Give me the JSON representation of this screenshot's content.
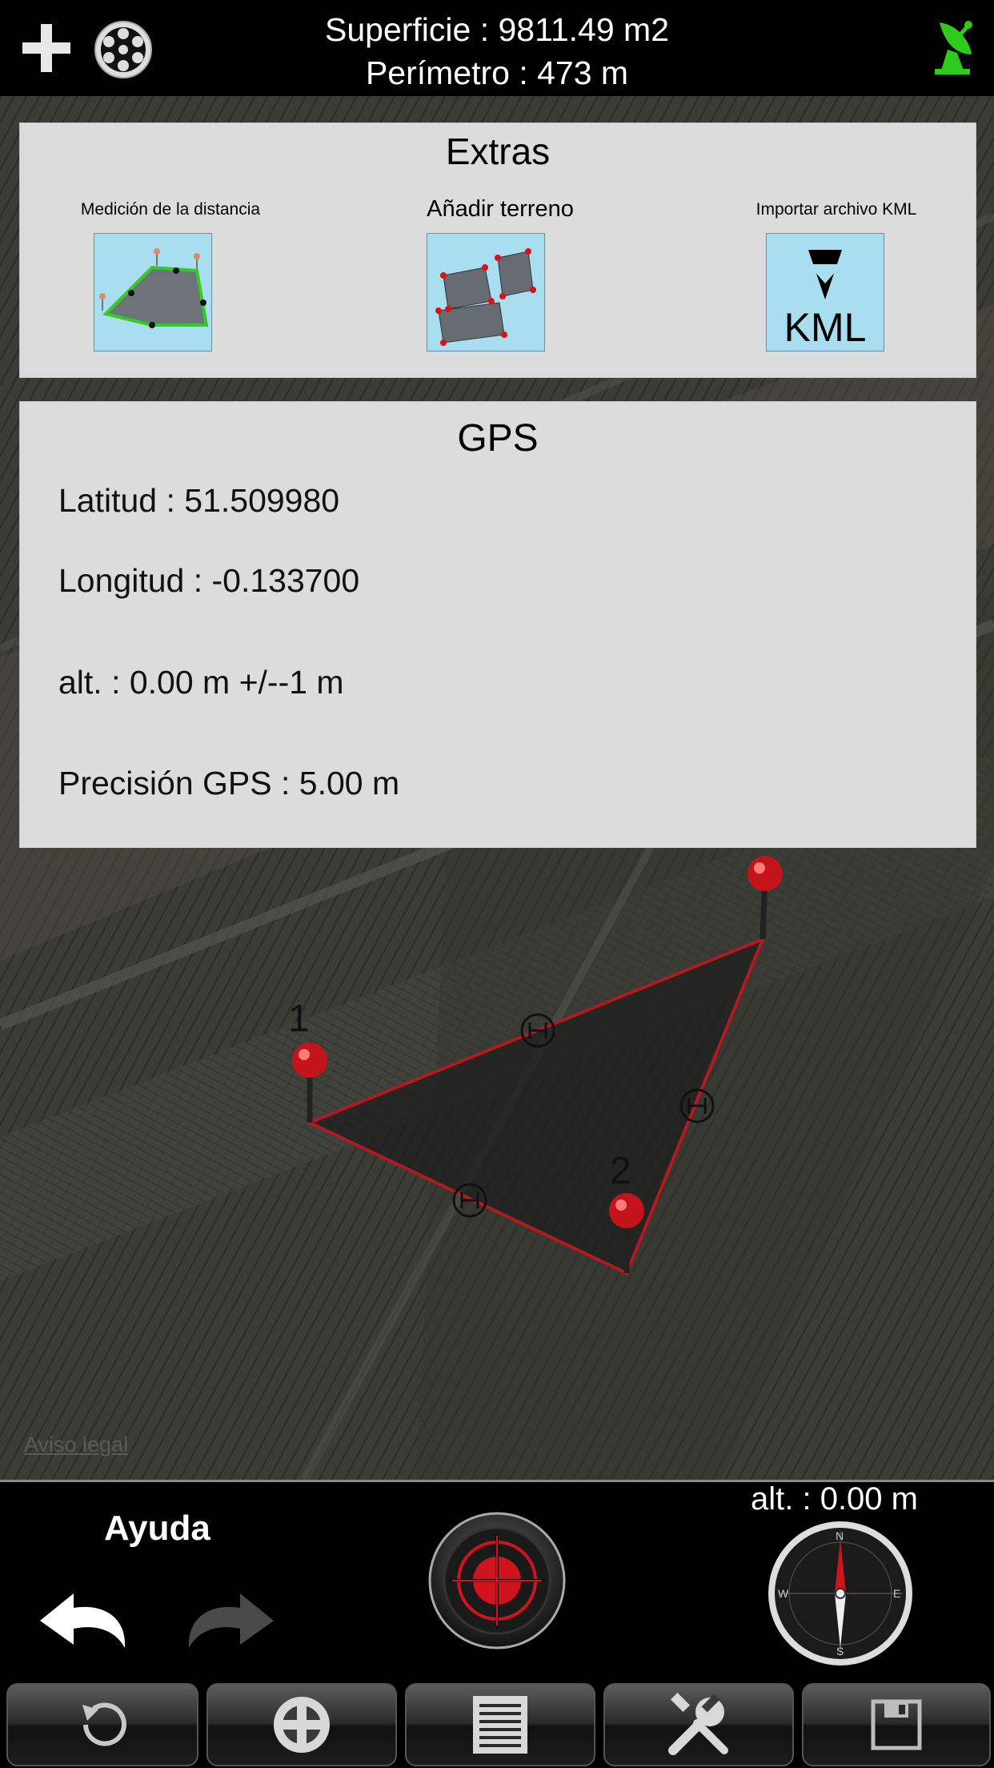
{
  "header": {
    "area_text": "Superficie : 9811.49 m2",
    "perimeter_text": "Perímetro : 473 m",
    "add_icon": "plus-icon",
    "layers_icon": "film-reel-icon",
    "gps_status_icon": "satellite-dish-icon",
    "gps_status_color": "#2ecc1a"
  },
  "extras": {
    "title": "Extras",
    "items": [
      {
        "label": "Medición de la distancia",
        "icon": "distance-measure-icon"
      },
      {
        "label": "Añadir terreno",
        "icon": "add-land-icon"
      },
      {
        "label": "Importar archivo KML",
        "icon": "kml-import-icon",
        "icon_text": "KML"
      }
    ]
  },
  "gps": {
    "title": "GPS",
    "latitude": "Latitud : 51.509980",
    "longitude": "Longitud : -0.133700",
    "altitude": "alt. : 0.00 m +/--1 m",
    "precision": "Precisión GPS : 5.00 m"
  },
  "map": {
    "pin_labels": [
      "1",
      "2"
    ],
    "legal_link": "Aviso legal",
    "polygon_color": "#c0191f"
  },
  "controls": {
    "help_label": "Ayuda",
    "altitude_text": "alt. : 0.00 m",
    "undo_icon": "undo-arrow-icon",
    "redo_icon": "redo-arrow-icon",
    "target_icon": "crosshair-target-icon",
    "compass_icon": "compass-icon",
    "compass_letters": [
      "N",
      "E",
      "S",
      "W"
    ]
  },
  "toolbar": {
    "buttons": [
      {
        "icon": "refresh-icon"
      },
      {
        "icon": "locate-crosshair-icon"
      },
      {
        "icon": "list-icon"
      },
      {
        "icon": "tools-icon"
      },
      {
        "icon": "save-icon"
      }
    ]
  }
}
